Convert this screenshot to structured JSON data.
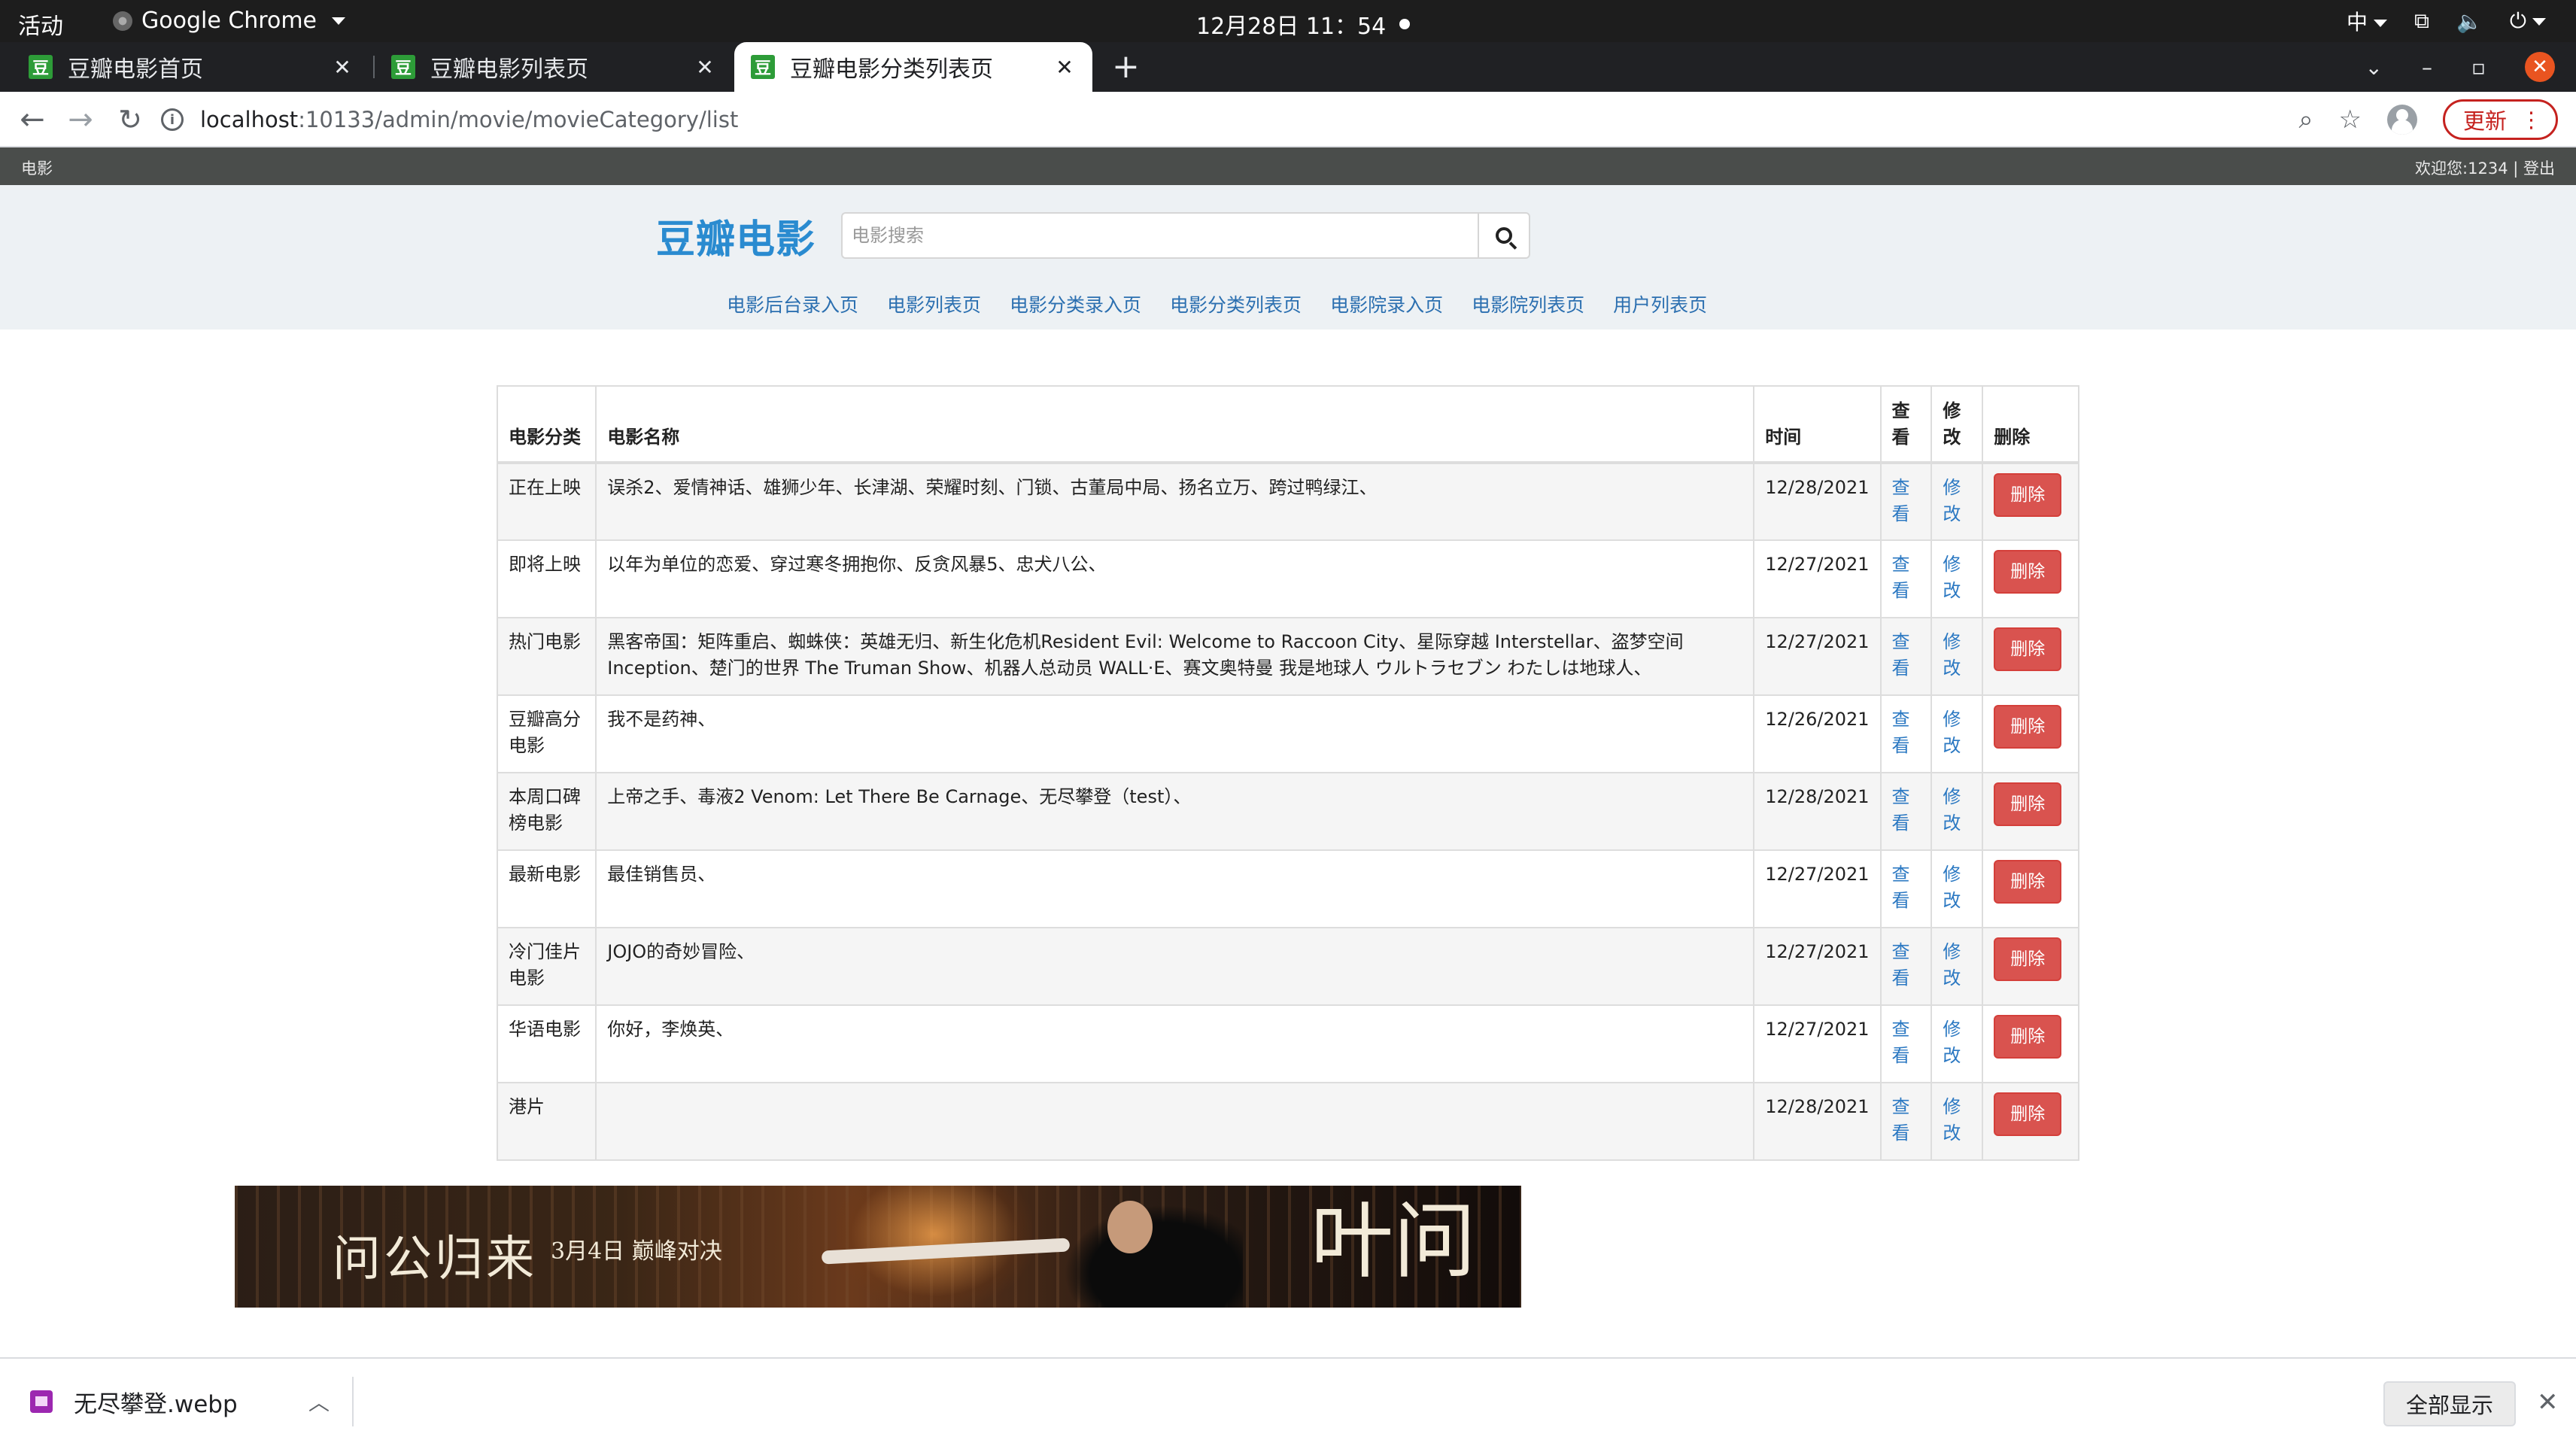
{
  "os": {
    "activities": "活动",
    "app_name": "Google Chrome",
    "clock": "12月28日  11：54",
    "input_method": "中"
  },
  "tabs": [
    {
      "favicon": "豆",
      "label": "豆瓣电影首页"
    },
    {
      "favicon": "豆",
      "label": "豆瓣电影列表页"
    },
    {
      "favicon": "豆",
      "label": "豆瓣电影分类列表页"
    }
  ],
  "omnibox": {
    "host": "localhost",
    "path": ":10133/admin/movie/movieCategory/list"
  },
  "toolbar": {
    "update_label": "更新"
  },
  "site_top": {
    "left": "电影",
    "right": "欢迎您:1234 | 登出"
  },
  "header": {
    "logo": "豆瓣电影",
    "search_placeholder": "电影搜索"
  },
  "subnav": [
    "电影后台录入页",
    "电影列表页",
    "电影分类录入页",
    "电影分类列表页",
    "电影院录入页",
    "电影院列表页",
    "用户列表页"
  ],
  "table": {
    "headers": {
      "category": "电影分类",
      "names": "电影名称",
      "time": "时间",
      "view": "查看",
      "edit": "修改",
      "delete": "删除"
    },
    "view_link": "查看",
    "edit_link": "修改",
    "delete_button": "删除",
    "rows": [
      {
        "category": "正在上映",
        "names": "误杀2、爱情神话、雄狮少年、长津湖、荣耀时刻、门锁、古董局中局、扬名立万、跨过鸭绿江、",
        "time": "12/28/2021"
      },
      {
        "category": "即将上映",
        "names": "以年为单位的恋爱、穿过寒冬拥抱你、反贪风暴5、忠犬八公、",
        "time": "12/27/2021"
      },
      {
        "category": "热门电影",
        "names": "黑客帝国：矩阵重启、蜘蛛侠：英雄无归、新生化危机Resident Evil: Welcome to Raccoon City、星际穿越 Interstellar、盗梦空间 Inception、楚门的世界 The Truman Show、机器人总动员 WALL·E、赛文奥特曼 我是地球人 ウルトラセブン わたしは地球人、",
        "time": "12/27/2021"
      },
      {
        "category": "豆瓣高分电影",
        "names": "我不是药神、",
        "time": "12/26/2021"
      },
      {
        "category": "本周口碑榜电影",
        "names": "上帝之手、毒液2 Venom: Let There Be Carnage、无尽攀登（test）、",
        "time": "12/28/2021"
      },
      {
        "category": "最新电影",
        "names": "最佳销售员、",
        "time": "12/27/2021"
      },
      {
        "category": "冷门佳片电影",
        "names": "JOJO的奇妙冒险、",
        "time": "12/27/2021"
      },
      {
        "category": "华语电影",
        "names": "你好，李焕英、",
        "time": "12/27/2021"
      },
      {
        "category": "港片",
        "names": "",
        "time": "12/28/2021"
      }
    ]
  },
  "banner": {
    "title_left": "问公归来",
    "date_text": "3月4日 巅峰对决",
    "title_right": "叶问"
  },
  "downloads": {
    "file_name": "无尽攀登.webp",
    "show_all": "全部显示"
  }
}
